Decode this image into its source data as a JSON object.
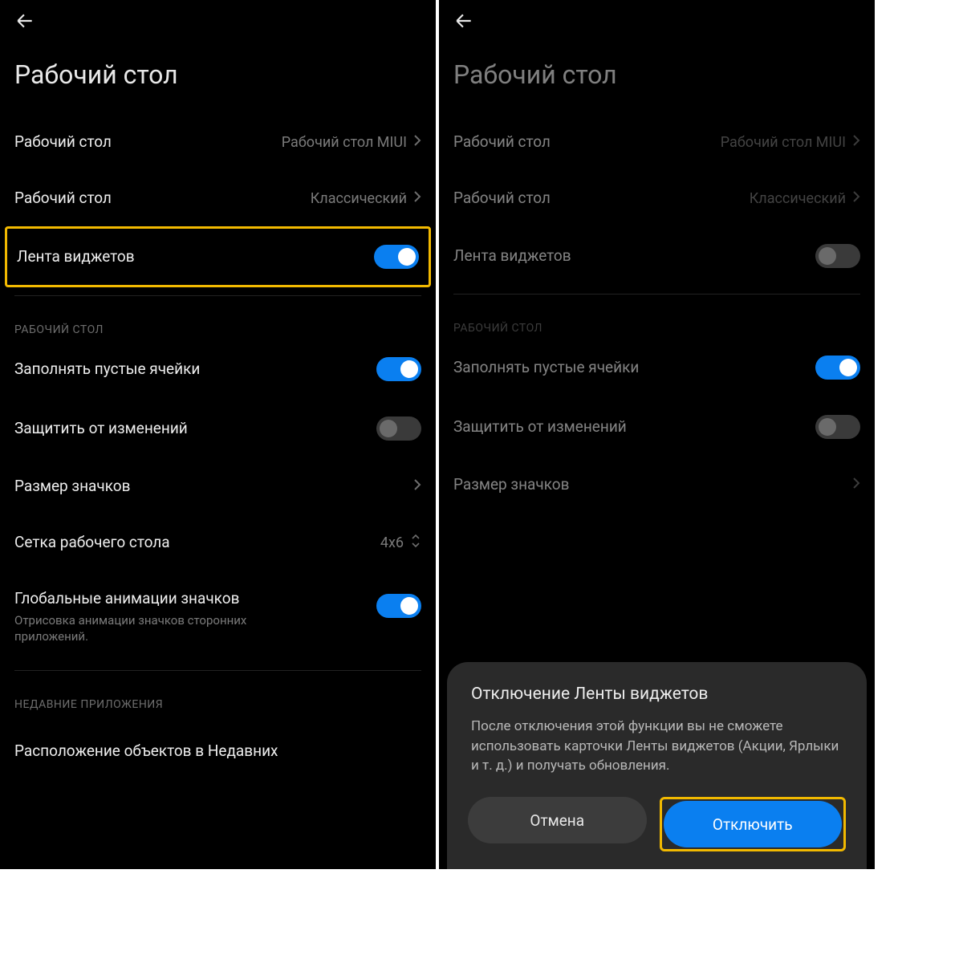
{
  "left": {
    "title": "Рабочий стол",
    "rows": {
      "launcher": {
        "label": "Рабочий стол",
        "value": "Рабочий стол MIUI"
      },
      "mode": {
        "label": "Рабочий стол",
        "value": "Классический"
      },
      "widgetFeed": {
        "label": "Лента виджетов",
        "on": true
      },
      "sectionDesktop": "РАБОЧИЙ СТОЛ",
      "fillCells": {
        "label": "Заполнять пустые ячейки",
        "on": true
      },
      "lock": {
        "label": "Защитить от изменений",
        "on": false
      },
      "iconSize": {
        "label": "Размер значков"
      },
      "grid": {
        "label": "Сетка рабочего стола",
        "value": "4x6"
      },
      "anim": {
        "label": "Глобальные анимации значков",
        "sub": "Отрисовка анимации значков сторонних приложений.",
        "on": true
      },
      "sectionRecent": "НЕДАВНИЕ ПРИЛОЖЕНИЯ",
      "recentLayout": {
        "label": "Расположение объектов в Недавних"
      }
    }
  },
  "right": {
    "title": "Рабочий стол",
    "rows": {
      "launcher": {
        "label": "Рабочий стол",
        "value": "Рабочий стол MIUI"
      },
      "mode": {
        "label": "Рабочий стол",
        "value": "Классический"
      },
      "widgetFeed": {
        "label": "Лента виджетов",
        "on": false
      },
      "sectionDesktop": "РАБОЧИЙ СТОЛ",
      "fillCells": {
        "label": "Заполнять пустые ячейки",
        "on": true
      },
      "lock": {
        "label": "Защитить от изменений",
        "on": false
      },
      "iconSize": {
        "label": "Размер значков"
      }
    },
    "modal": {
      "title": "Отключение Ленты виджетов",
      "body": "После отключения этой функции вы не сможете использовать карточки Ленты виджетов (Акции, Ярлыки и т. д.) и получать обновления.",
      "cancel": "Отмена",
      "confirm": "Отключить"
    }
  }
}
